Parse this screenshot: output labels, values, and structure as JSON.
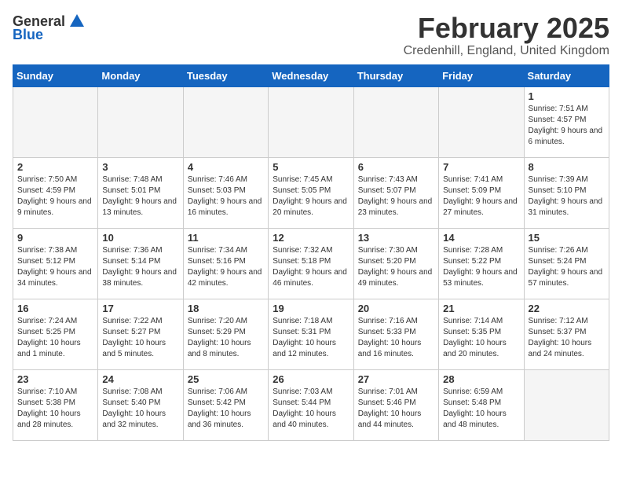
{
  "logo": {
    "general": "General",
    "blue": "Blue"
  },
  "title": "February 2025",
  "location": "Credenhill, England, United Kingdom",
  "weekdays": [
    "Sunday",
    "Monday",
    "Tuesday",
    "Wednesday",
    "Thursday",
    "Friday",
    "Saturday"
  ],
  "weeks": [
    [
      {
        "day": "",
        "info": ""
      },
      {
        "day": "",
        "info": ""
      },
      {
        "day": "",
        "info": ""
      },
      {
        "day": "",
        "info": ""
      },
      {
        "day": "",
        "info": ""
      },
      {
        "day": "",
        "info": ""
      },
      {
        "day": "1",
        "info": "Sunrise: 7:51 AM\nSunset: 4:57 PM\nDaylight: 9 hours and 6 minutes."
      }
    ],
    [
      {
        "day": "2",
        "info": "Sunrise: 7:50 AM\nSunset: 4:59 PM\nDaylight: 9 hours and 9 minutes."
      },
      {
        "day": "3",
        "info": "Sunrise: 7:48 AM\nSunset: 5:01 PM\nDaylight: 9 hours and 13 minutes."
      },
      {
        "day": "4",
        "info": "Sunrise: 7:46 AM\nSunset: 5:03 PM\nDaylight: 9 hours and 16 minutes."
      },
      {
        "day": "5",
        "info": "Sunrise: 7:45 AM\nSunset: 5:05 PM\nDaylight: 9 hours and 20 minutes."
      },
      {
        "day": "6",
        "info": "Sunrise: 7:43 AM\nSunset: 5:07 PM\nDaylight: 9 hours and 23 minutes."
      },
      {
        "day": "7",
        "info": "Sunrise: 7:41 AM\nSunset: 5:09 PM\nDaylight: 9 hours and 27 minutes."
      },
      {
        "day": "8",
        "info": "Sunrise: 7:39 AM\nSunset: 5:10 PM\nDaylight: 9 hours and 31 minutes."
      }
    ],
    [
      {
        "day": "9",
        "info": "Sunrise: 7:38 AM\nSunset: 5:12 PM\nDaylight: 9 hours and 34 minutes."
      },
      {
        "day": "10",
        "info": "Sunrise: 7:36 AM\nSunset: 5:14 PM\nDaylight: 9 hours and 38 minutes."
      },
      {
        "day": "11",
        "info": "Sunrise: 7:34 AM\nSunset: 5:16 PM\nDaylight: 9 hours and 42 minutes."
      },
      {
        "day": "12",
        "info": "Sunrise: 7:32 AM\nSunset: 5:18 PM\nDaylight: 9 hours and 46 minutes."
      },
      {
        "day": "13",
        "info": "Sunrise: 7:30 AM\nSunset: 5:20 PM\nDaylight: 9 hours and 49 minutes."
      },
      {
        "day": "14",
        "info": "Sunrise: 7:28 AM\nSunset: 5:22 PM\nDaylight: 9 hours and 53 minutes."
      },
      {
        "day": "15",
        "info": "Sunrise: 7:26 AM\nSunset: 5:24 PM\nDaylight: 9 hours and 57 minutes."
      }
    ],
    [
      {
        "day": "16",
        "info": "Sunrise: 7:24 AM\nSunset: 5:25 PM\nDaylight: 10 hours and 1 minute."
      },
      {
        "day": "17",
        "info": "Sunrise: 7:22 AM\nSunset: 5:27 PM\nDaylight: 10 hours and 5 minutes."
      },
      {
        "day": "18",
        "info": "Sunrise: 7:20 AM\nSunset: 5:29 PM\nDaylight: 10 hours and 8 minutes."
      },
      {
        "day": "19",
        "info": "Sunrise: 7:18 AM\nSunset: 5:31 PM\nDaylight: 10 hours and 12 minutes."
      },
      {
        "day": "20",
        "info": "Sunrise: 7:16 AM\nSunset: 5:33 PM\nDaylight: 10 hours and 16 minutes."
      },
      {
        "day": "21",
        "info": "Sunrise: 7:14 AM\nSunset: 5:35 PM\nDaylight: 10 hours and 20 minutes."
      },
      {
        "day": "22",
        "info": "Sunrise: 7:12 AM\nSunset: 5:37 PM\nDaylight: 10 hours and 24 minutes."
      }
    ],
    [
      {
        "day": "23",
        "info": "Sunrise: 7:10 AM\nSunset: 5:38 PM\nDaylight: 10 hours and 28 minutes."
      },
      {
        "day": "24",
        "info": "Sunrise: 7:08 AM\nSunset: 5:40 PM\nDaylight: 10 hours and 32 minutes."
      },
      {
        "day": "25",
        "info": "Sunrise: 7:06 AM\nSunset: 5:42 PM\nDaylight: 10 hours and 36 minutes."
      },
      {
        "day": "26",
        "info": "Sunrise: 7:03 AM\nSunset: 5:44 PM\nDaylight: 10 hours and 40 minutes."
      },
      {
        "day": "27",
        "info": "Sunrise: 7:01 AM\nSunset: 5:46 PM\nDaylight: 10 hours and 44 minutes."
      },
      {
        "day": "28",
        "info": "Sunrise: 6:59 AM\nSunset: 5:48 PM\nDaylight: 10 hours and 48 minutes."
      },
      {
        "day": "",
        "info": ""
      }
    ]
  ]
}
